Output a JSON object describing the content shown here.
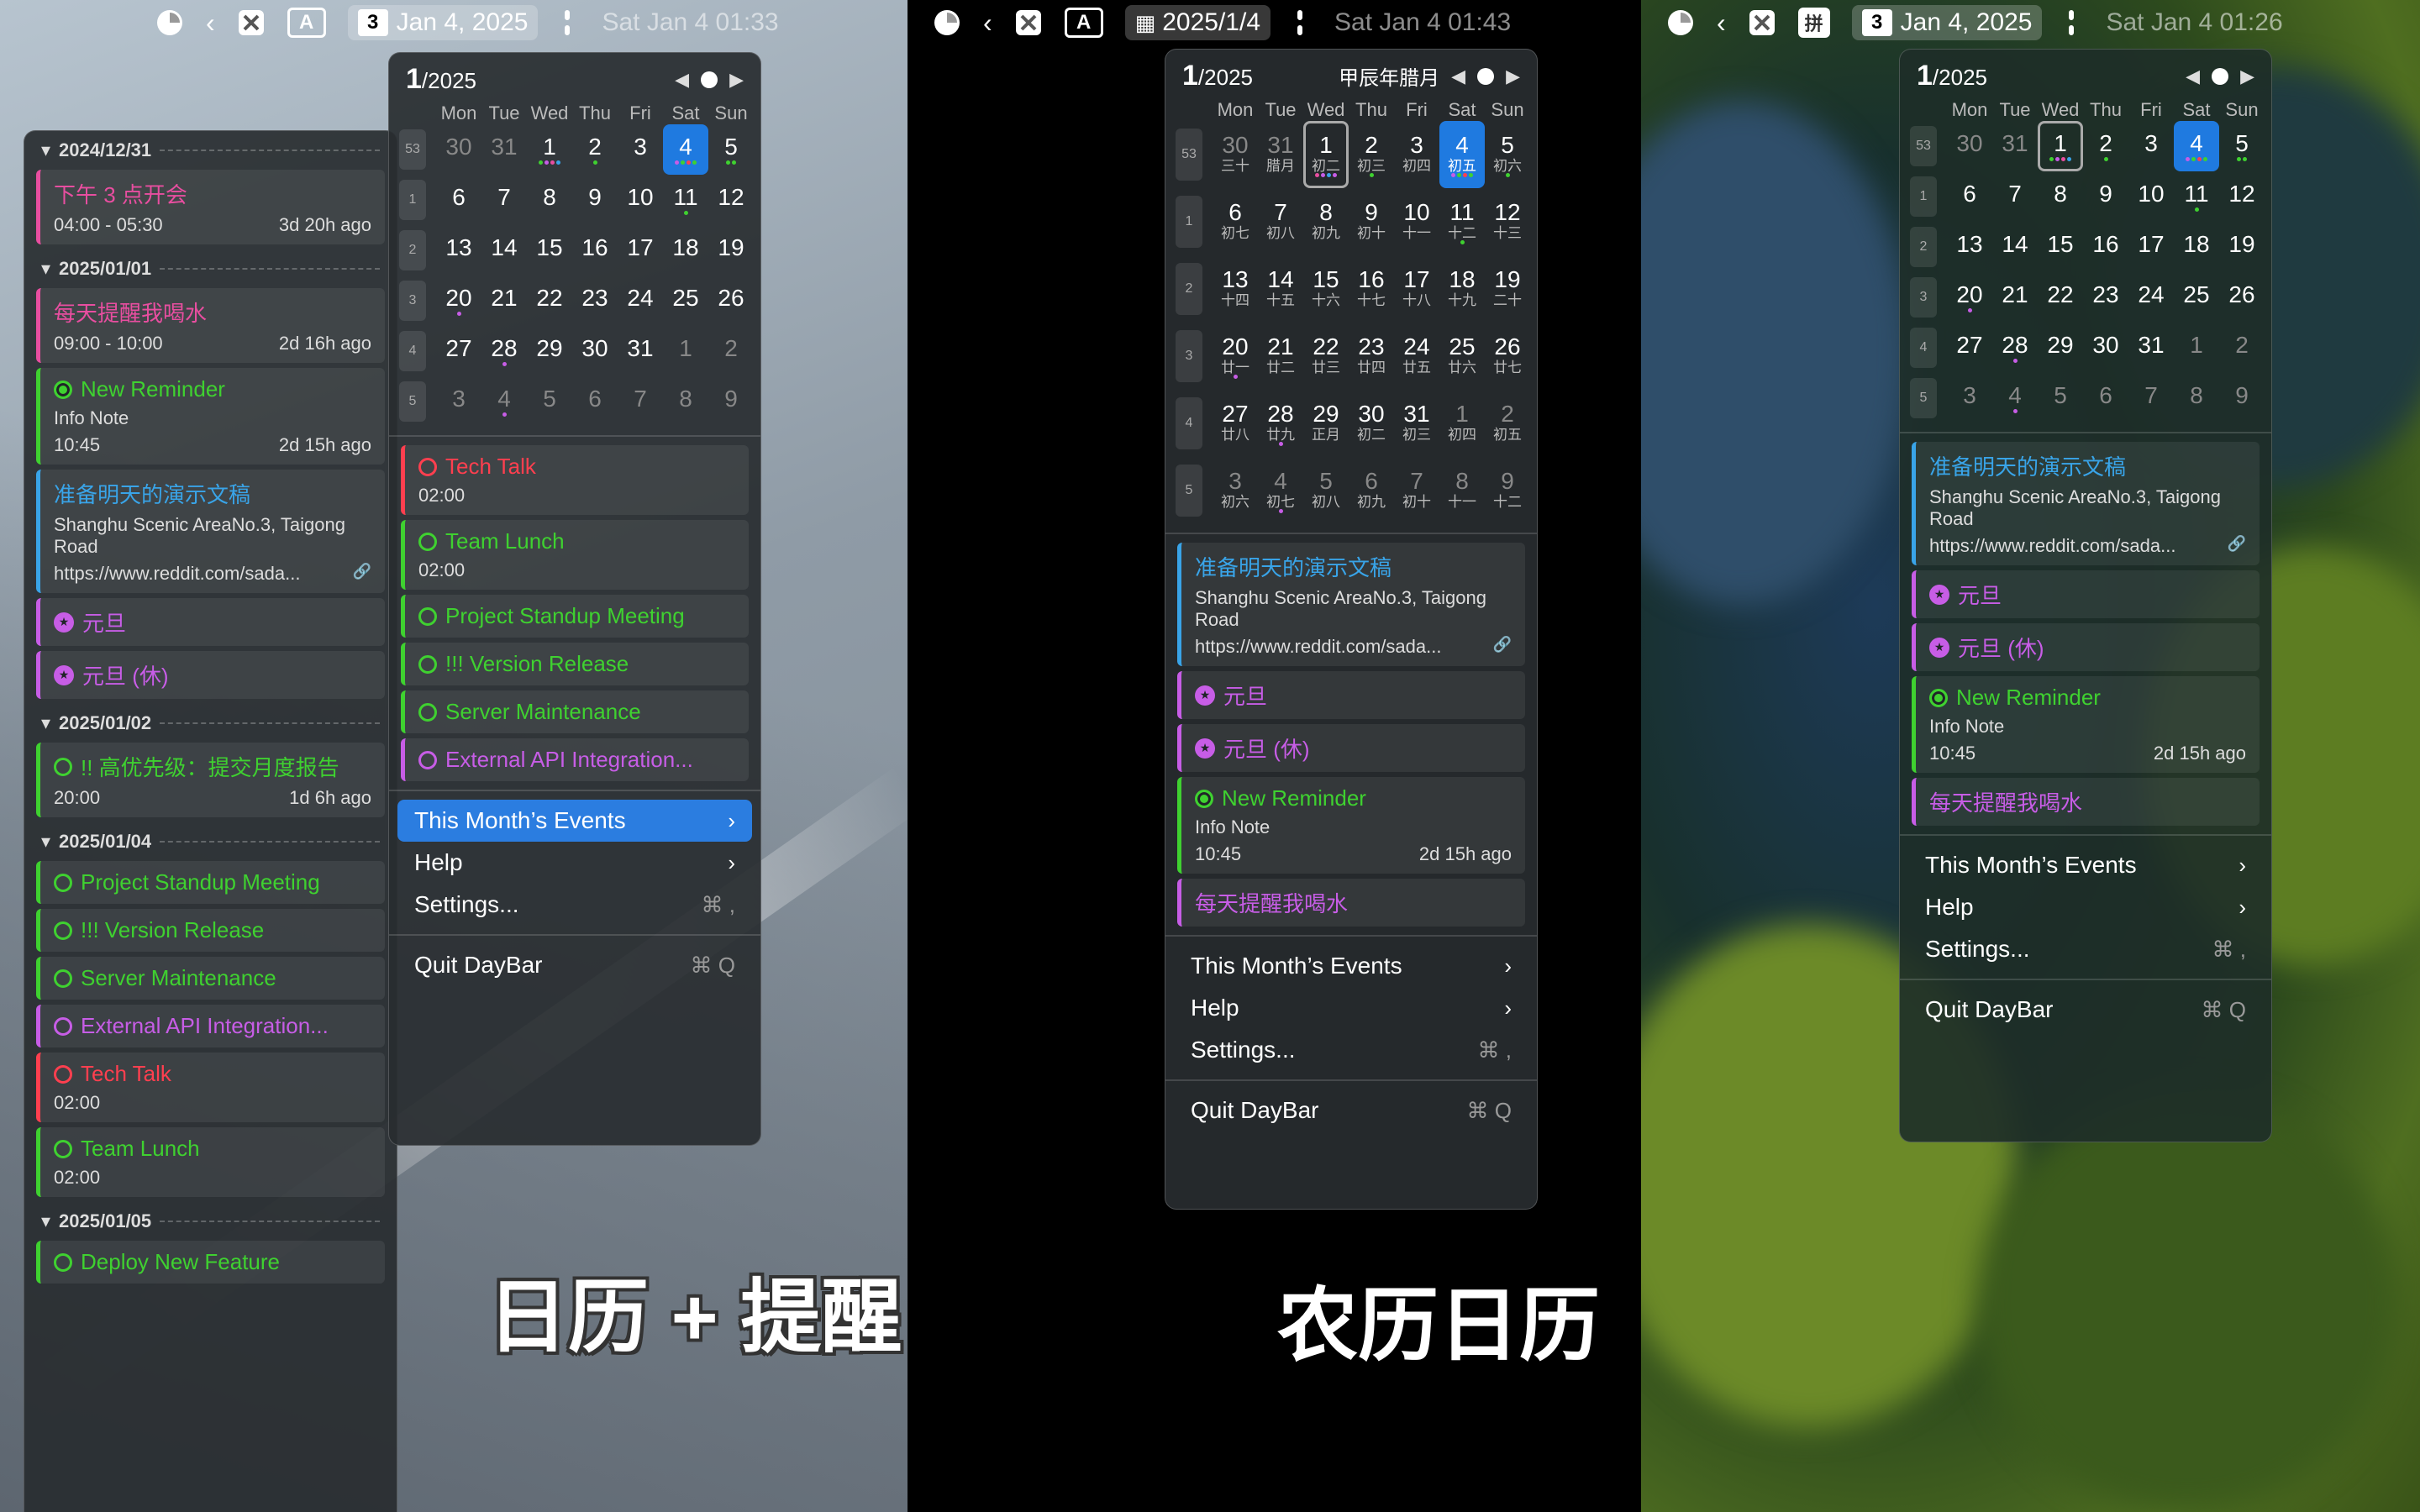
{
  "colors": {
    "pink": "#e84ea0",
    "green": "#3fd130",
    "blue": "#39a4e8",
    "purple": "#c75de6",
    "red": "#ff3f4f",
    "selected": "#1f7ae0"
  },
  "weekdays": [
    "Mon",
    "Tue",
    "Wed",
    "Thu",
    "Fri",
    "Sat",
    "Sun"
  ],
  "captions": {
    "left": "日历 + 提醒",
    "middle": "农历日历"
  },
  "menubar1": {
    "date_badge": "3",
    "date": "Jan 4, 2025",
    "clock": "Sat Jan 4  01:33",
    "input": "A"
  },
  "menubar2": {
    "date": "2025/1/4",
    "clock": "Sat Jan 4  01:43",
    "input": "A"
  },
  "menubar3": {
    "date_badge": "3",
    "date": "Jan 4, 2025",
    "clock": "Sat Jan 4  01:26",
    "input": "拼"
  },
  "cal": {
    "month": "1",
    "year": "/2025",
    "lunar_title": "甲辰年腊月"
  },
  "menu": {
    "month_events": "This Month’s Events",
    "help": "Help",
    "settings": "Settings...",
    "settings_key": "⌘ ,",
    "quit": "Quit DayBar",
    "quit_key": "⌘ Q"
  },
  "reminders_list": {
    "groups": [
      {
        "date": "2024/12/31",
        "items": [
          {
            "title": "下午 3 点开会",
            "sub": "04:00 - 05:30",
            "ago": "3d 20h ago"
          }
        ]
      },
      {
        "date": "2025/01/01",
        "items": [
          {
            "title": "每天提醒我喝水",
            "sub": "09:00 - 10:00",
            "ago": "2d 16h ago"
          },
          {
            "title": "New Reminder",
            "note": "Info Note",
            "sub": "10:45",
            "ago": "2d 15h ago"
          },
          {
            "title": "准备明天的演示文稿",
            "note": "Shanghu Scenic AreaNo.3, Taigong Road",
            "sub": "https://www.reddit.com/sada..."
          },
          {
            "title": "元旦"
          },
          {
            "title": "元旦 (休)"
          }
        ]
      },
      {
        "date": "2025/01/02",
        "items": [
          {
            "title": "!! 高优先级：提交月度报告",
            "sub": "20:00",
            "ago": "1d 6h ago"
          }
        ]
      },
      {
        "date": "2025/01/04",
        "items": [
          {
            "title": "Project Standup Meeting"
          },
          {
            "title": "!!! Version Release"
          },
          {
            "title": "Server Maintenance"
          },
          {
            "title": "External API Integration..."
          },
          {
            "title": "Tech Talk",
            "sub": "02:00"
          },
          {
            "title": "Team Lunch",
            "sub": "02:00"
          }
        ]
      },
      {
        "date": "2025/01/05",
        "items": [
          {
            "title": "Deploy New Feature"
          }
        ]
      }
    ]
  },
  "popup1_events": [
    {
      "title": "Tech Talk",
      "sub": "02:00"
    },
    {
      "title": "Team Lunch",
      "sub": "02:00"
    },
    {
      "title": "Project Standup Meeting"
    },
    {
      "title": "!!! Version Release"
    },
    {
      "title": "Server Maintenance"
    },
    {
      "title": "External API Integration..."
    }
  ],
  "popup2_events": [
    {
      "title": "准备明天的演示文稿",
      "note": "Shanghu Scenic AreaNo.3, Taigong Road",
      "sub": "https://www.reddit.com/sada..."
    },
    {
      "title": "元旦"
    },
    {
      "title": "元旦 (休)"
    },
    {
      "title": "New Reminder",
      "note": "Info Note",
      "sub": "10:45",
      "ago": "2d 15h ago"
    },
    {
      "title": "每天提醒我喝水"
    }
  ]
}
